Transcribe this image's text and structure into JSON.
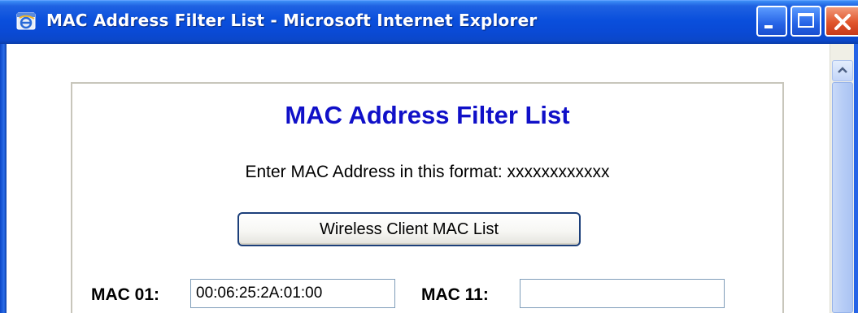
{
  "window": {
    "title": "MAC Address Filter List - Microsoft Internet Explorer",
    "icon": "ie-icon",
    "controls": [
      "minimize-icon",
      "maximize-icon",
      "close-icon"
    ]
  },
  "page": {
    "heading": "MAC Address Filter List",
    "format_hint": "Enter MAC Address in this format: xxxxxxxxxxxx",
    "wireless_button_label": "Wireless Client MAC List",
    "entries": [
      {
        "label": "MAC 01:",
        "value": "00:06:25:2A:01:00"
      },
      {
        "label": "MAC 11:",
        "value": ""
      }
    ]
  },
  "colors": {
    "heading": "#1010c8",
    "titlebar": "#0a4fdc",
    "close_button": "#e0552c"
  }
}
